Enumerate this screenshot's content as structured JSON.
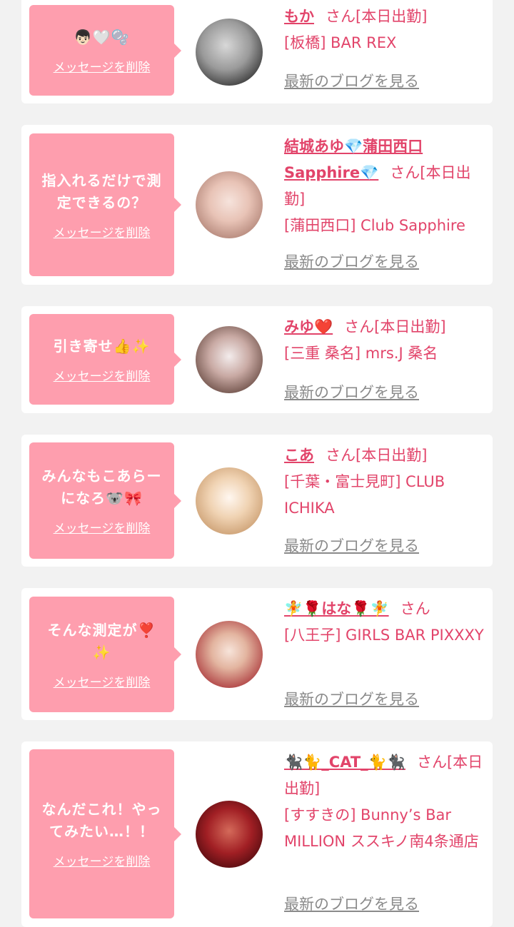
{
  "items": [
    {
      "message": "👦🏻🤍🫧",
      "delete_label": "メッセージを削除",
      "name": "もか",
      "suffix": "さん[本日出勤]",
      "shop": "[板橋] BAR REX",
      "blog_link": "最新のブログを見る"
    },
    {
      "message": "指入れるだけで測\n定できるの？",
      "delete_label": "メッセージを削除",
      "name": "結城あゆ💎蒲田西口Sapphire💎",
      "suffix": "さん[本日出勤]",
      "shop": "[蒲田西口] Club Sapphire",
      "blog_link": "最新のブログを見る"
    },
    {
      "message": "引き寄せ👍✨",
      "delete_label": "メッセージを削除",
      "name": "みゆ❤️",
      "suffix": "さん[本日出勤]",
      "shop": "[三重 桑名] mrs.J 桑名",
      "blog_link": "最新のブログを見る"
    },
    {
      "message": "みんなもこあらー\nになろ🐨🎀",
      "delete_label": "メッセージを削除",
      "name": "こあ",
      "suffix": "さん[本日出勤]",
      "shop": "[千葉・富士見町] CLUB ICHIKA",
      "blog_link": "最新のブログを見る"
    },
    {
      "message": "そんな測定が❣️\n✨",
      "delete_label": "メッセージを削除",
      "name": "🧚🌹はな🌹🧚",
      "suffix": "さん",
      "shop": "[八王子] GIRLS BAR PIXXXY",
      "blog_link": "最新のブログを見る"
    },
    {
      "message": "なんだこれ！やっ\nてみたい…！！",
      "delete_label": "メッセージを削除",
      "name": "🐈‍⬛🐈_CAT_🐈🐈‍⬛",
      "suffix": "さん[本日出勤]",
      "shop": "[すすきの] Bunny’s Bar MILLION ススキノ南4条通店",
      "blog_link": "最新のブログを見る"
    }
  ],
  "colors": {
    "accent": "#e2446a",
    "bubble": "#fe9eae",
    "background": "#f2f2f2",
    "link_gray": "#8a8a8a"
  }
}
